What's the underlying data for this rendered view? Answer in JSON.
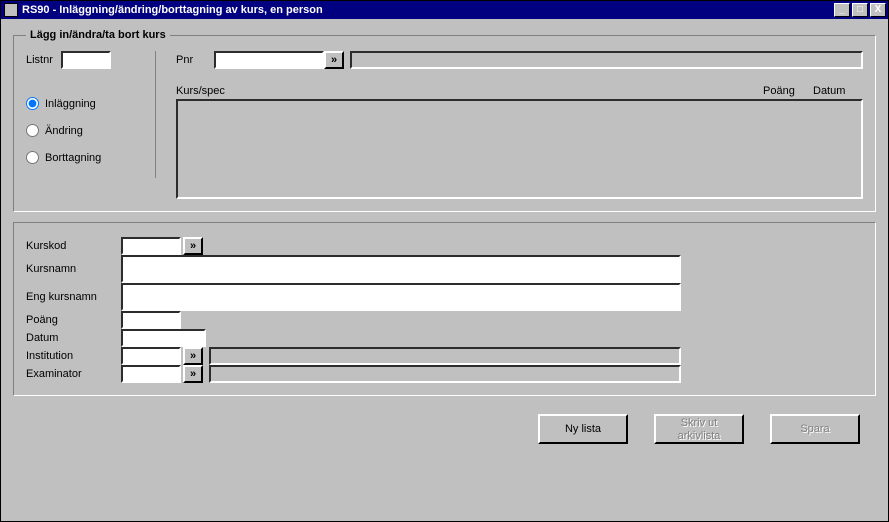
{
  "window": {
    "title": "RS90 - Inläggning/ändring/borttagning av kurs, en person"
  },
  "group1": {
    "legend": "Lägg in/ändra/ta bort kurs",
    "listnr_label": "Listnr",
    "pnr_label": "Pnr",
    "radios": {
      "inlaggning": "Inläggning",
      "andring": "Ändring",
      "borttagning": "Borttagning"
    },
    "cols": {
      "kursspec": "Kurs/spec",
      "poang": "Poäng",
      "datum": "Datum"
    },
    "lookup_btn": "»"
  },
  "group2": {
    "kurskod": "Kurskod",
    "kursnamn": "Kursnamn",
    "eng_kursnamn": "Eng kursnamn",
    "poang": "Poäng",
    "datum": "Datum",
    "institution": "Institution",
    "examinator": "Examinator",
    "lookup_btn": "»"
  },
  "buttons": {
    "ny_lista": "Ny lista",
    "skriv_ut": "Skriv ut arkivlista",
    "spara": "Spara"
  }
}
